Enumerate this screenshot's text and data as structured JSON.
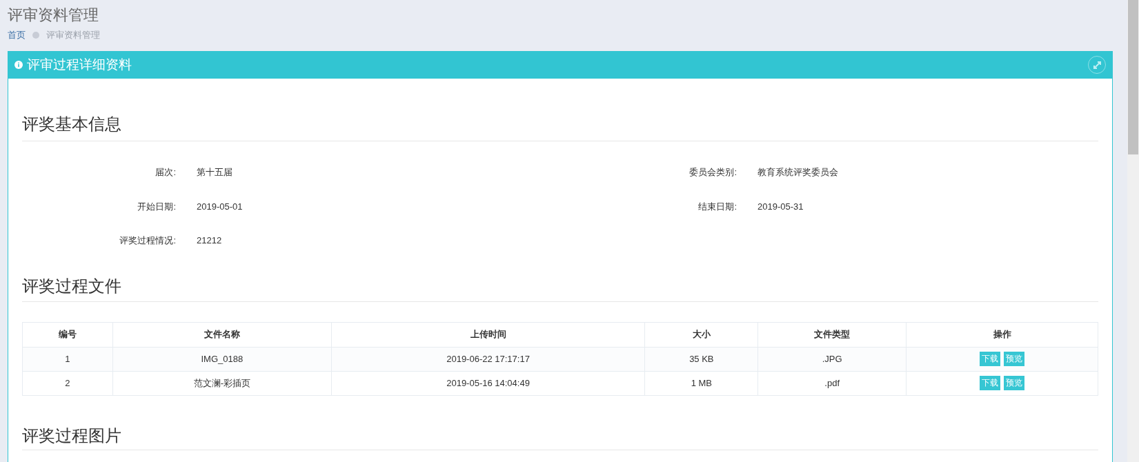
{
  "page_title": "评审资料管理",
  "breadcrumb": [
    {
      "label": "首页",
      "kind": "link"
    },
    {
      "label": "评审资料管理",
      "kind": "current"
    }
  ],
  "panel": {
    "title": "评审过程详细资料",
    "basic_info": {
      "heading": "评奖基本信息",
      "fields": [
        {
          "label": "届次:",
          "value": "第十五届"
        },
        {
          "label": "委员会类别:",
          "value": "教育系统评奖委员会"
        },
        {
          "label": "开始日期:",
          "value": "2019-05-01"
        },
        {
          "label": "结束日期:",
          "value": "2019-05-31"
        },
        {
          "label": "评奖过程情况:",
          "value": "21212"
        }
      ]
    },
    "files": {
      "heading": "评奖过程文件",
      "columns": [
        "编号",
        "文件名称",
        "上传时间",
        "大小",
        "文件类型",
        "操作"
      ],
      "rows": [
        {
          "cells": [
            "1",
            "IMG_0188",
            "2019-06-22 17:17:17",
            "35 KB",
            ".JPG"
          ],
          "actions": [
            "下载",
            "预览"
          ]
        },
        {
          "cells": [
            "2",
            "范文澜-彩插页",
            "2019-05-16 14:04:49",
            "1 MB",
            ".pdf"
          ],
          "actions": [
            "下载",
            "预览"
          ]
        }
      ]
    },
    "images": {
      "heading": "评奖过程图片"
    }
  }
}
